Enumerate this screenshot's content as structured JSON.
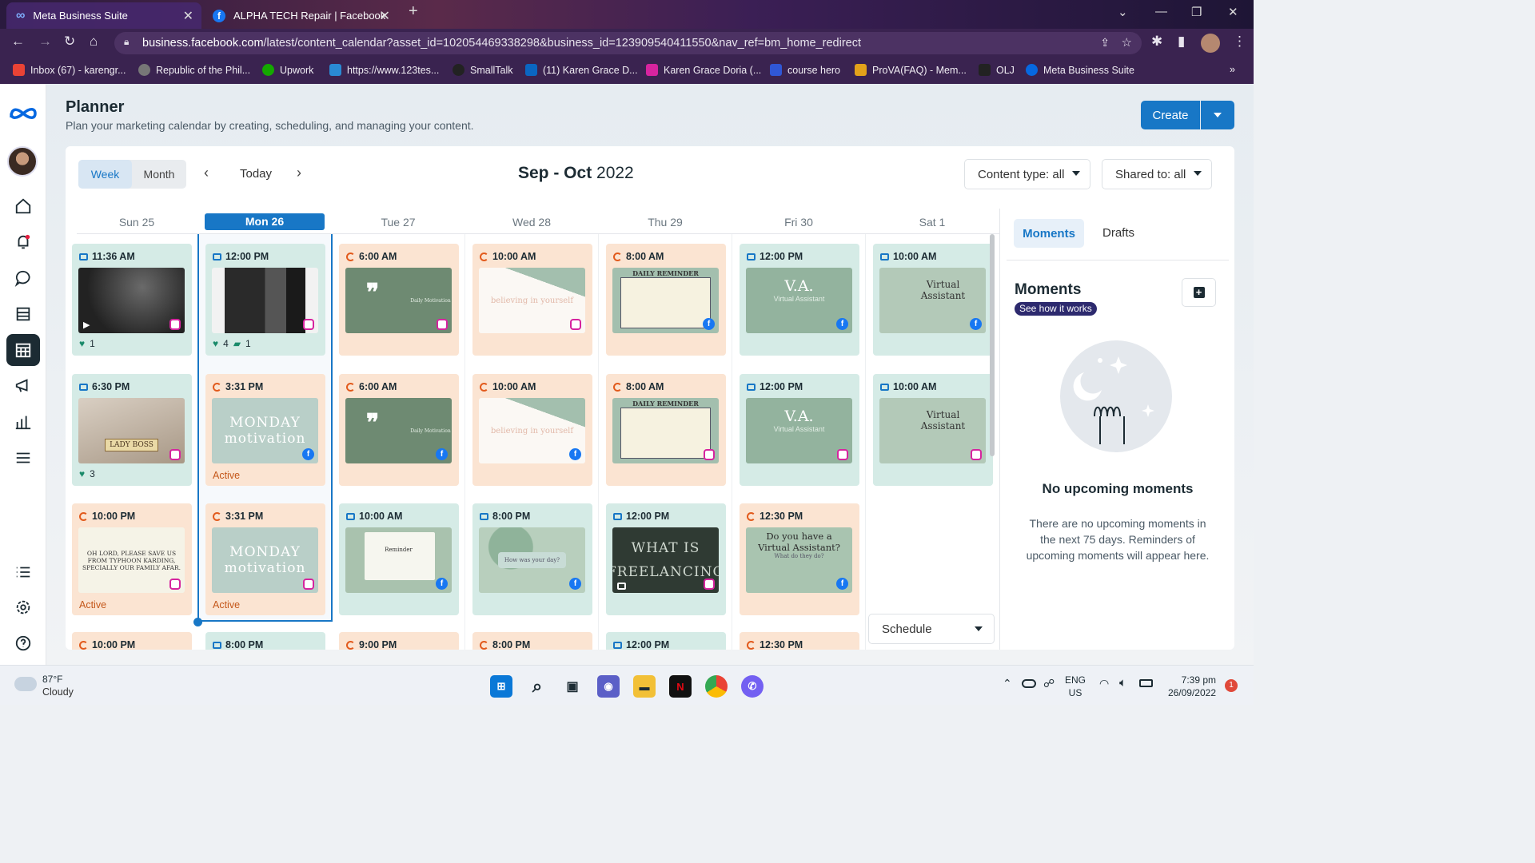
{
  "browser": {
    "tabs": [
      {
        "title": "Meta Business Suite"
      },
      {
        "title": "ALPHA TECH Repair | Facebook"
      }
    ],
    "url_domain": "business.facebook.com",
    "url_path": "/latest/content_calendar?asset_id=102054469338298&business_id=123909540411550&nav_ref=bm_home_redirect",
    "bookmarks": [
      {
        "label": "Inbox (67) - karengr...",
        "icon": "gmail-icon",
        "color": "#ea4335"
      },
      {
        "label": "Republic of the Phil...",
        "icon": "globe-icon",
        "color": "#777777"
      },
      {
        "label": "Upwork",
        "icon": "upwork-icon",
        "color": "#14a800"
      },
      {
        "label": "https://www.123tes...",
        "icon": "link-icon",
        "color": "#2a8ad4"
      },
      {
        "label": "SmallTalk",
        "icon": "smalltalk-icon",
        "color": "#222222"
      },
      {
        "label": "(11) Karen Grace D...",
        "icon": "linkedin-icon",
        "color": "#0a66c2"
      },
      {
        "label": "Karen Grace Doria (...",
        "icon": "instagram-icon",
        "color": "#d6249f"
      },
      {
        "label": "course hero",
        "icon": "coursehero-icon",
        "color": "#3057d6"
      },
      {
        "label": "ProVA(FAQ) - Mem...",
        "icon": "prova-icon",
        "color": "#e3a21a"
      },
      {
        "label": "OLJ",
        "icon": "olj-icon",
        "color": "#222222"
      },
      {
        "label": "Meta Business Suite",
        "icon": "meta-icon",
        "color": "#0668e1"
      }
    ]
  },
  "header": {
    "title": "Planner",
    "subtitle": "Plan your marketing calendar by creating, scheduling, and managing your content.",
    "create_label": "Create"
  },
  "toolbar": {
    "week_label": "Week",
    "month_label": "Month",
    "today_label": "Today",
    "range_bold": "Sep - Oct",
    "range_year": " 2022",
    "content_type": "Content type: all",
    "shared_to": "Shared to: all"
  },
  "days": [
    "Sun 25",
    "Mon 26",
    "Tue 27",
    "Wed 28",
    "Thu 29",
    "Fri 30",
    "Sat 1"
  ],
  "posts": [
    {
      "time": "11:36 AM",
      "kind": "published",
      "platform": "ig",
      "thumb": "dark photo",
      "likes": "1",
      "comments": ""
    },
    {
      "time": "6:30 PM",
      "kind": "published",
      "platform": "ig",
      "thumb": "LADY BOSS",
      "likes": "3",
      "comments": ""
    },
    {
      "time": "10:00 PM",
      "kind": "scheduled",
      "platform": "ig",
      "thumb": "OH LORD, PLEASE SAVE US FROM TYPHOON KARDING, SPECIALLY OUR FAMILY AFAR.",
      "status": "Active"
    },
    {
      "time": "10:00 PM",
      "kind": "scheduled"
    },
    {
      "time": "12:00 PM",
      "kind": "published",
      "platform": "ig",
      "thumb": "collage photo",
      "likes": "4",
      "comments": "1"
    },
    {
      "time": "3:31 PM",
      "kind": "scheduled",
      "platform": "fb",
      "thumb": "MONDAY motivation",
      "status": "Active"
    },
    {
      "time": "3:31 PM",
      "kind": "scheduled",
      "platform": "ig",
      "thumb": "MONDAY motivation",
      "status": "Active"
    },
    {
      "time": "8:00 PM",
      "kind": "published"
    },
    {
      "time": "6:00 AM",
      "kind": "scheduled",
      "platform": "ig",
      "thumb": "Daily Motivation"
    },
    {
      "time": "6:00 AM",
      "kind": "scheduled",
      "platform": "fb",
      "thumb": "Daily Motivation"
    },
    {
      "time": "10:00 AM",
      "kind": "published",
      "platform": "fb",
      "thumb": "Reminder"
    },
    {
      "time": "9:00 PM",
      "kind": "scheduled"
    },
    {
      "time": "10:00 AM",
      "kind": "scheduled",
      "platform": "ig",
      "thumb": "believing in yourself"
    },
    {
      "time": "10:00 AM",
      "kind": "scheduled",
      "platform": "fb",
      "thumb": "believing in yourself"
    },
    {
      "time": "8:00 PM",
      "kind": "published",
      "platform": "fb",
      "thumb": "How was your day?"
    },
    {
      "time": "8:00 PM",
      "kind": "scheduled"
    },
    {
      "time": "8:00 AM",
      "kind": "scheduled",
      "platform": "fb",
      "thumb": "DAILY REMINDER"
    },
    {
      "time": "8:00 AM",
      "kind": "scheduled",
      "platform": "ig",
      "thumb": "DAILY REMINDER"
    },
    {
      "time": "12:00 PM",
      "kind": "published",
      "platform": "ig",
      "thumb": "WHAT IS FREELANCING"
    },
    {
      "time": "12:00 PM",
      "kind": "published"
    },
    {
      "time": "12:00 PM",
      "kind": "published",
      "platform": "fb",
      "thumb": "V.A.",
      "thumb_sub": "Virtual Assistant"
    },
    {
      "time": "12:00 PM",
      "kind": "published",
      "platform": "ig",
      "thumb": "V.A.",
      "thumb_sub": "Virtual Assistant"
    },
    {
      "time": "12:30 PM",
      "kind": "scheduled",
      "platform": "fb",
      "thumb": "Do you have a Virtual Assistant?",
      "thumb_sub": "What do they do?"
    },
    {
      "time": "12:30 PM",
      "kind": "scheduled"
    },
    {
      "time": "10:00 AM",
      "kind": "published",
      "platform": "fb",
      "thumb": "Virtual Assistant"
    },
    {
      "time": "10:00 AM",
      "kind": "published",
      "platform": "ig",
      "thumb": "Virtual Assistant"
    }
  ],
  "schedule_label": "Schedule",
  "right_panel": {
    "tab_moments": "Moments",
    "tab_drafts": "Drafts",
    "title": "Moments",
    "how_label": "See how it works",
    "empty_title": "No upcoming moments",
    "empty_desc": "There are no upcoming moments in the next 75 days. Reminders of upcoming moments will appear here."
  },
  "taskbar": {
    "temp": "87°F",
    "condition": "Cloudy",
    "lang1": "ENG",
    "lang2": "US",
    "time": "7:39 pm",
    "date": "26/09/2022",
    "notifications": "1"
  }
}
